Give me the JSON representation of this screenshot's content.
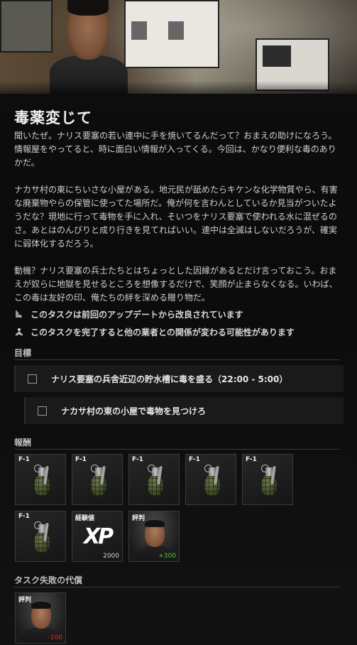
{
  "quest": {
    "title": "毒薬変じて",
    "description": [
      "聞いたぜ。ナリス要塞の若い連中に手を焼いてるんだって？おまえの助けになろう。情報屋をやってると、時に面白い情報が入ってくる。今回は、かなり便利な毒のありかだ。",
      "ナカサ村の東にちいさな小屋がある。地元民が舐めたらキケンな化学物質やら、有害な廃棄物やらの保管に使ってた場所だ。俺が何を言わんとしているか見当がついたようだな？現地に行って毒物を手に入れ、そいつをナリス要塞で使われる水に混ぜるのさ。あとはのんびりと成り行きを見てればいい。連中は全滅はしないだろうが、確実に弱体化するだろう。",
      "動機？ナリス要塞の兵士たちとはちょっとした因縁があるとだけ言っておこう。おまえが奴らに地獄を見せるところを想像するだけで、笑顔が止まらなくなる。いわば、この毒は友好の印、俺たちの絆を深める贈り物だ。"
    ],
    "notes": [
      {
        "icon": "update-icon",
        "text": "このタスクは前回のアップデートから改良されています"
      },
      {
        "icon": "relationship-icon",
        "text": "このタスクを完了すると他の業者との関係が変わる可能性があります"
      }
    ]
  },
  "objectives": {
    "label": "目標",
    "items": [
      {
        "text": "ナリス要塞の兵舎近辺の貯水槽に毒を盛る（22:00 - 5:00）"
      },
      {
        "text": "ナカサ村の東の小屋で毒物を見つけろ"
      }
    ]
  },
  "rewards": {
    "label": "報酬",
    "items": [
      {
        "kind": "grenade",
        "label": "F-1"
      },
      {
        "kind": "grenade",
        "label": "F-1"
      },
      {
        "kind": "grenade",
        "label": "F-1"
      },
      {
        "kind": "grenade",
        "label": "F-1"
      },
      {
        "kind": "grenade",
        "label": "F-1"
      },
      {
        "kind": "grenade",
        "label": "F-1"
      },
      {
        "kind": "xp",
        "label": "経験値",
        "count": "2000",
        "logo": "XP"
      },
      {
        "kind": "reputation",
        "label": "評判",
        "count": "+300"
      }
    ]
  },
  "failure": {
    "label": "タスク失敗の代償",
    "items": [
      {
        "kind": "reputation",
        "label": "評判",
        "count": "-100"
      }
    ]
  },
  "colors": {
    "positive": "#57c43a",
    "negative": "#d23030"
  }
}
